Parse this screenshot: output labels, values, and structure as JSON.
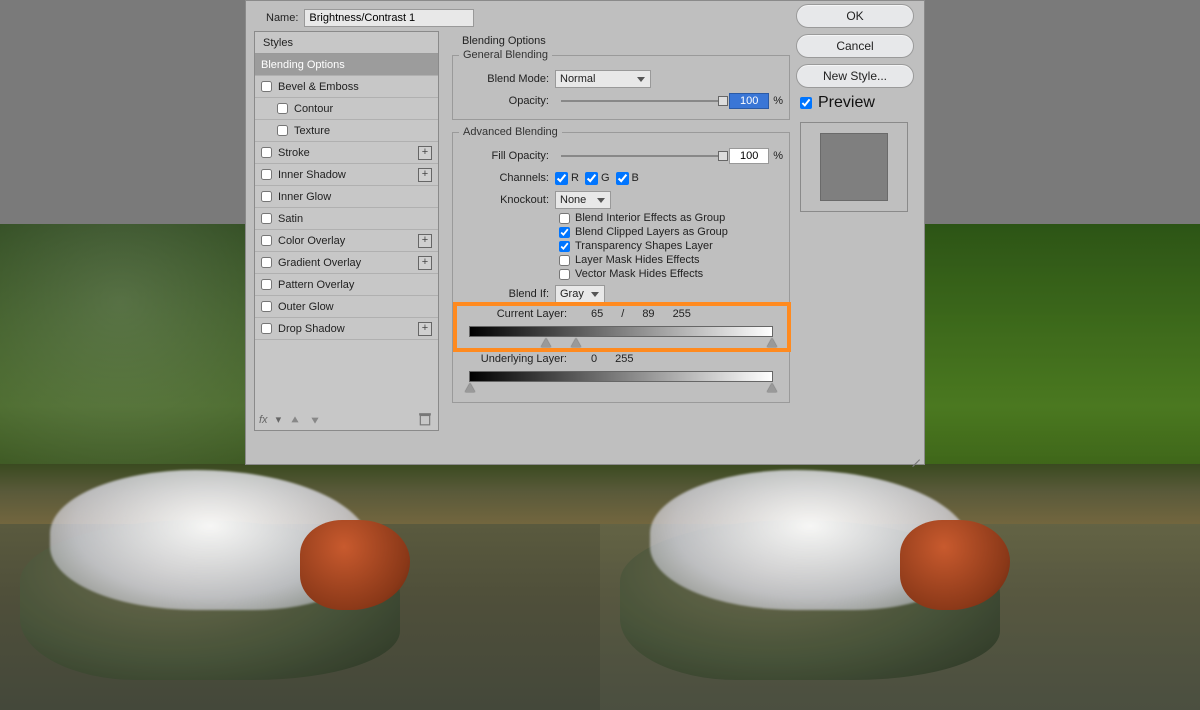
{
  "name_label": "Name:",
  "name_value": "Brightness/Contrast 1",
  "styles_header": "Styles",
  "styles": [
    {
      "label": "Blending Options",
      "selected": true,
      "check": false,
      "plus": false,
      "sub": false
    },
    {
      "label": "Bevel & Emboss",
      "selected": false,
      "check": true,
      "plus": false,
      "sub": false
    },
    {
      "label": "Contour",
      "selected": false,
      "check": true,
      "plus": false,
      "sub": true
    },
    {
      "label": "Texture",
      "selected": false,
      "check": true,
      "plus": false,
      "sub": true
    },
    {
      "label": "Stroke",
      "selected": false,
      "check": true,
      "plus": true,
      "sub": false
    },
    {
      "label": "Inner Shadow",
      "selected": false,
      "check": true,
      "plus": true,
      "sub": false
    },
    {
      "label": "Inner Glow",
      "selected": false,
      "check": true,
      "plus": false,
      "sub": false
    },
    {
      "label": "Satin",
      "selected": false,
      "check": true,
      "plus": false,
      "sub": false
    },
    {
      "label": "Color Overlay",
      "selected": false,
      "check": true,
      "plus": true,
      "sub": false
    },
    {
      "label": "Gradient Overlay",
      "selected": false,
      "check": true,
      "plus": true,
      "sub": false
    },
    {
      "label": "Pattern Overlay",
      "selected": false,
      "check": true,
      "plus": false,
      "sub": false
    },
    {
      "label": "Outer Glow",
      "selected": false,
      "check": true,
      "plus": false,
      "sub": false
    },
    {
      "label": "Drop Shadow",
      "selected": false,
      "check": true,
      "plus": true,
      "sub": false
    }
  ],
  "fx_label": "fx",
  "center": {
    "title": "Blending Options",
    "general_legend": "General Blending",
    "blend_mode_label": "Blend Mode:",
    "blend_mode_value": "Normal",
    "opacity_label": "Opacity:",
    "opacity_value": "100",
    "advanced_legend": "Advanced Blending",
    "fill_opacity_label": "Fill Opacity:",
    "fill_opacity_value": "100",
    "channels_label": "Channels:",
    "channel_r": "R",
    "channel_g": "G",
    "channel_b": "B",
    "knockout_label": "Knockout:",
    "knockout_value": "None",
    "opt_blend_interior": "Blend Interior Effects as Group",
    "opt_blend_clipped": "Blend Clipped Layers as Group",
    "opt_transparency": "Transparency Shapes Layer",
    "opt_layer_mask": "Layer Mask Hides Effects",
    "opt_vector_mask": "Vector Mask Hides Effects",
    "blendif_label": "Blend If:",
    "blendif_value": "Gray",
    "current_layer_label": "Current Layer:",
    "current_vals": [
      "65",
      "/",
      "89",
      "255"
    ],
    "underlying_label": "Underlying Layer:",
    "underlying_vals": [
      "0",
      "255"
    ],
    "pct": "%"
  },
  "right": {
    "ok": "OK",
    "cancel": "Cancel",
    "new_style": "New Style...",
    "preview": "Preview"
  }
}
